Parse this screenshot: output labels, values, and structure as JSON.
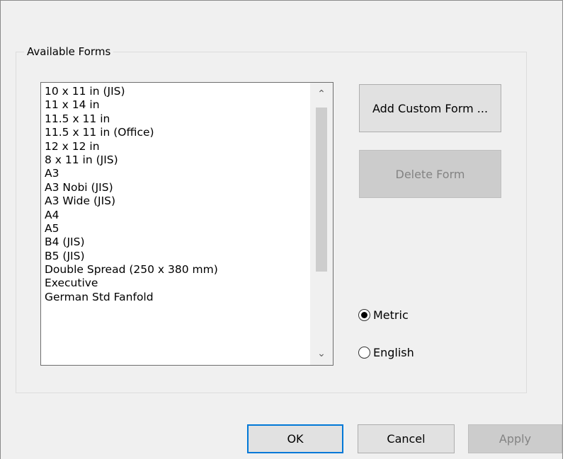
{
  "group": {
    "title": "Available Forms"
  },
  "forms_list": {
    "items": [
      "10 x 11 in (JIS)",
      "11 x 14 in",
      "11.5 x 11 in",
      "11.5 x 11 in (Office)",
      "12 x 12 in",
      "8 x 11 in (JIS)",
      "A3",
      "A3 Nobi (JIS)",
      "A3 Wide (JIS)",
      "A4",
      "A5",
      "B4 (JIS)",
      "B5 (JIS)",
      "Double Spread (250 x 380 mm)",
      "Executive",
      "German Std Fanfold"
    ],
    "scroll_up_glyph": "⌃",
    "scroll_down_glyph": "⌄"
  },
  "actions": {
    "add_custom_form": "Add Custom Form ...",
    "delete_form": "Delete Form"
  },
  "units": {
    "metric": {
      "label": "Metric",
      "selected": true
    },
    "english": {
      "label": "English",
      "selected": false
    }
  },
  "footer": {
    "ok": "OK",
    "cancel": "Cancel",
    "apply": "Apply"
  },
  "colors": {
    "dialog_bg": "#f0f0f0",
    "default_button_border": "#0078d7",
    "disabled_text": "#838383"
  }
}
